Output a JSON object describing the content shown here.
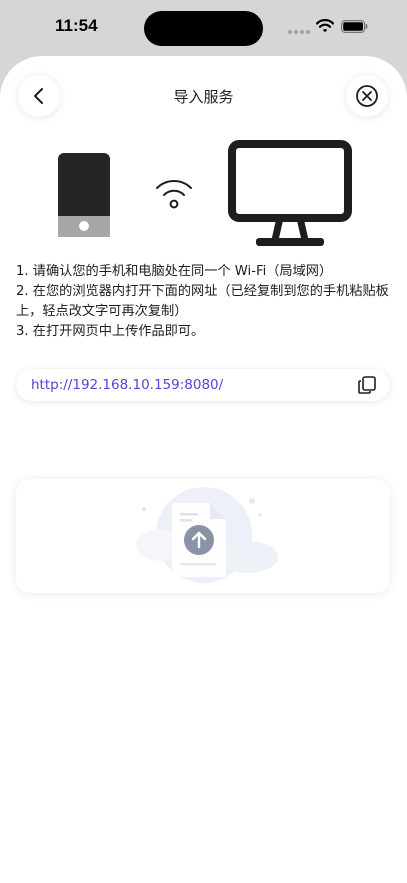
{
  "status_bar": {
    "time": "11:54"
  },
  "header": {
    "title": "导入服务",
    "back_icon": "chevron-left-icon",
    "close_icon": "close-circle-icon"
  },
  "illustration": {
    "phone_icon": "phone-icon",
    "wifi_icon": "wifi-icon",
    "monitor_icon": "monitor-icon"
  },
  "instructions": [
    "1. 请确认您的手机和电脑处在同一个 Wi-Fi（局域网）",
    "2. 在您的浏览器内打开下面的网址（已经复制到您的手机粘贴板上，轻点改文字可再次复制）",
    "3. 在打开网页中上传作品即可。"
  ],
  "url": {
    "text": "http://192.168.10.159:8080/",
    "copy_icon": "copy-icon"
  },
  "upload": {
    "icon": "upload-file-icon"
  },
  "colors": {
    "link": "#5b3fd8",
    "background": "#ffffff",
    "status_bar_bg": "#d6d6d6"
  }
}
